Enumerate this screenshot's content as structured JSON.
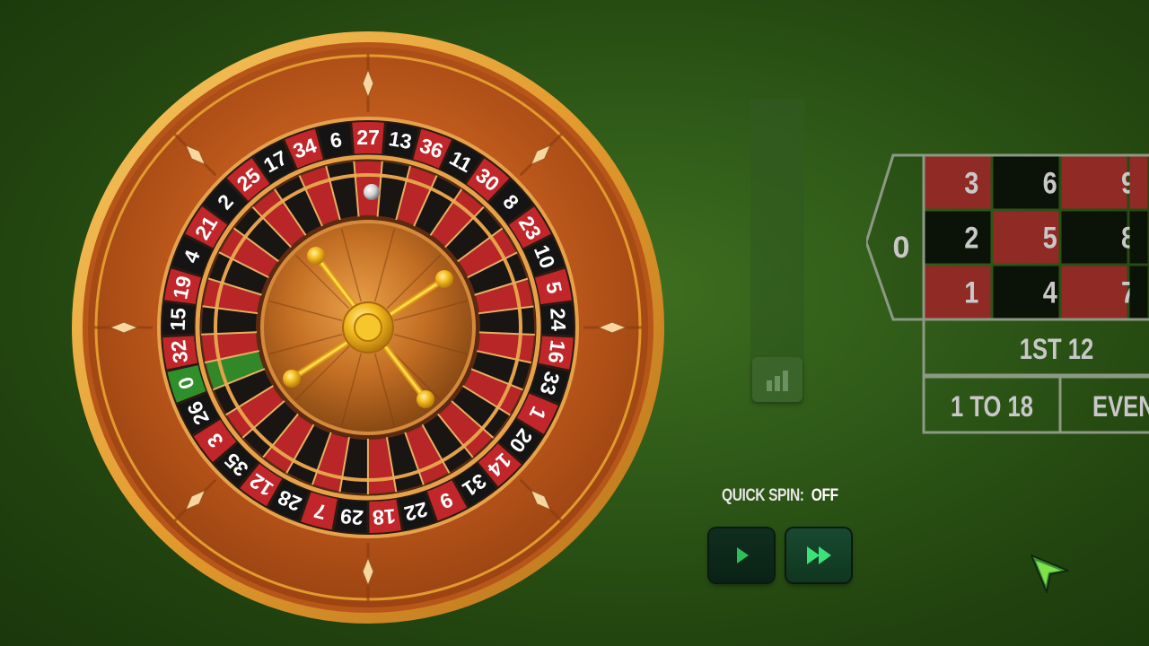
{
  "wheel": {
    "sequence": [
      "0",
      "32",
      "15",
      "19",
      "4",
      "21",
      "2",
      "25",
      "17",
      "34",
      "6",
      "27",
      "13",
      "36",
      "11",
      "30",
      "8",
      "23",
      "10",
      "5",
      "24",
      "16",
      "33",
      "1",
      "20",
      "14",
      "31",
      "9",
      "22",
      "18",
      "29",
      "7",
      "28",
      "12",
      "35",
      "3",
      "26"
    ],
    "red_numbers": [
      "1",
      "3",
      "5",
      "7",
      "9",
      "12",
      "14",
      "16",
      "18",
      "19",
      "21",
      "23",
      "25",
      "27",
      "30",
      "32",
      "34",
      "36"
    ],
    "colors": {
      "red": "#c0262a",
      "black": "#141414",
      "green": "#2f8f2a",
      "gold": "#e8a83a"
    }
  },
  "board": {
    "zero_label": "0",
    "grid": [
      [
        {
          "n": "3",
          "color": "red"
        },
        {
          "n": "6",
          "color": "black"
        },
        {
          "n": "9",
          "color": "red"
        }
      ],
      [
        {
          "n": "2",
          "color": "black"
        },
        {
          "n": "5",
          "color": "red"
        },
        {
          "n": "8",
          "color": "black"
        }
      ],
      [
        {
          "n": "1",
          "color": "red"
        },
        {
          "n": "4",
          "color": "black"
        },
        {
          "n": "7",
          "color": "red"
        }
      ]
    ],
    "dozen_label": "1ST 12",
    "low_label": "1 TO 18",
    "even_label": "EVEN"
  },
  "controls": {
    "quick_spin_label": "QUICK SPIN:",
    "quick_spin_state": "OFF",
    "play_icon": "play-icon",
    "fast_icon": "fast-forward-icon",
    "history_icon": "bar-chart-icon"
  }
}
